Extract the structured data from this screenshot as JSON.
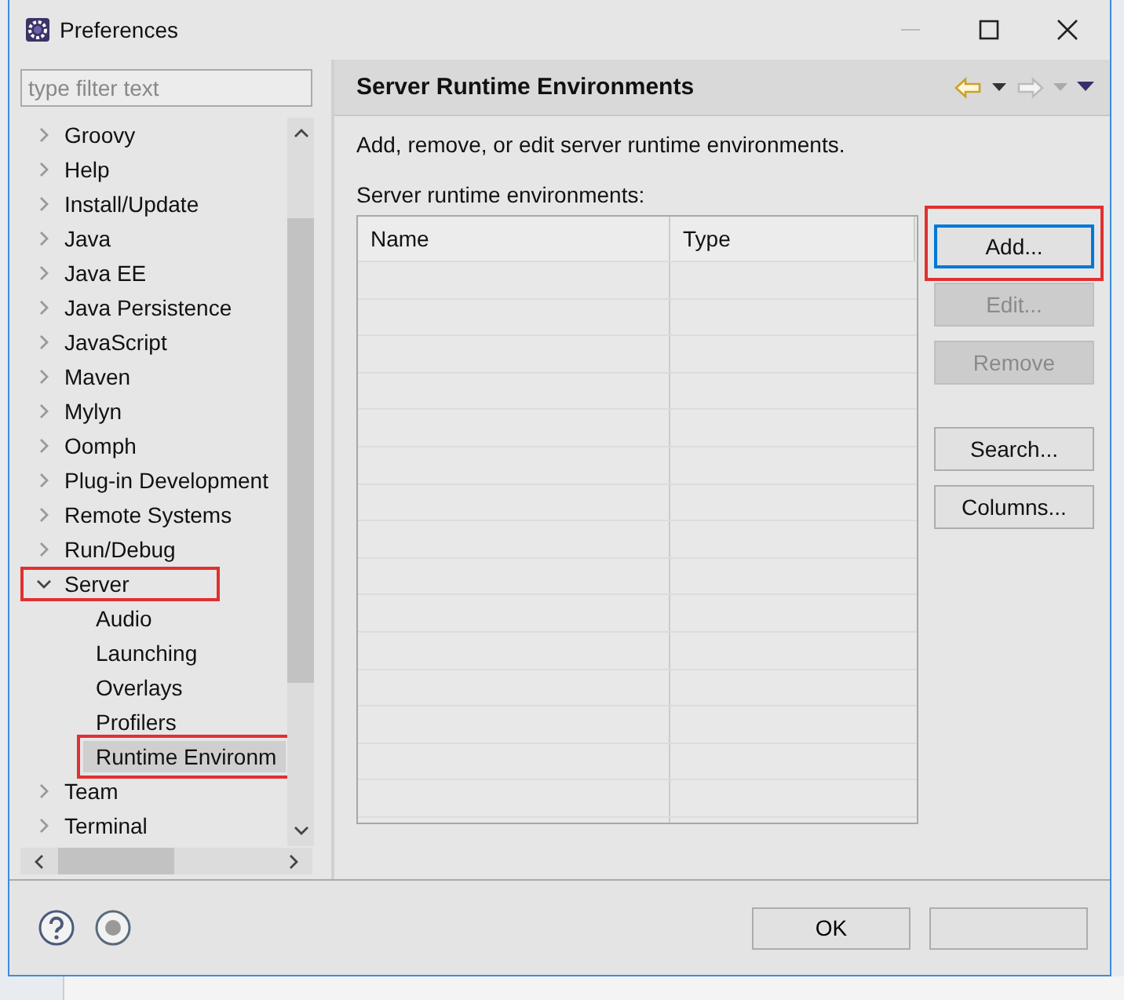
{
  "window": {
    "title": "Preferences"
  },
  "filter": {
    "placeholder": "type filter text"
  },
  "tree": [
    {
      "label": "Groovy",
      "expanded": false
    },
    {
      "label": "Help",
      "expanded": false
    },
    {
      "label": "Install/Update",
      "expanded": false
    },
    {
      "label": "Java",
      "expanded": false
    },
    {
      "label": "Java EE",
      "expanded": false
    },
    {
      "label": "Java Persistence",
      "expanded": false
    },
    {
      "label": "JavaScript",
      "expanded": false
    },
    {
      "label": "Maven",
      "expanded": false
    },
    {
      "label": "Mylyn",
      "expanded": false
    },
    {
      "label": "Oomph",
      "expanded": false
    },
    {
      "label": "Plug-in Development",
      "expanded": false
    },
    {
      "label": "Remote Systems",
      "expanded": false
    },
    {
      "label": "Run/Debug",
      "expanded": false
    },
    {
      "label": "Server",
      "expanded": true,
      "highlighted": true,
      "children": [
        {
          "label": "Audio",
          "selected": false
        },
        {
          "label": "Launching",
          "selected": false
        },
        {
          "label": "Overlays",
          "selected": false
        },
        {
          "label": "Profilers",
          "selected": false
        },
        {
          "label": "Runtime Environm",
          "selected": true
        }
      ]
    },
    {
      "label": "Team",
      "expanded": false
    },
    {
      "label": "Terminal",
      "expanded": false
    }
  ],
  "page": {
    "title": "Server Runtime Environments",
    "description": "Add, remove, or edit server runtime environments.",
    "table_label": "Server runtime environments:"
  },
  "table": {
    "columns": [
      "Name",
      "Type"
    ]
  },
  "buttons": [
    {
      "label": "Add...",
      "disabled": false,
      "focused": true,
      "highlighted": true
    },
    {
      "label": "Edit...",
      "disabled": true,
      "focused": false,
      "highlighted": false
    },
    {
      "label": "Remove",
      "disabled": true,
      "focused": false,
      "highlighted": false
    },
    {
      "label": "Search...",
      "disabled": false,
      "focused": false,
      "highlighted": false
    },
    {
      "label": "Columns...",
      "disabled": false,
      "focused": false,
      "highlighted": false
    }
  ],
  "footer": {
    "ok": "OK"
  }
}
